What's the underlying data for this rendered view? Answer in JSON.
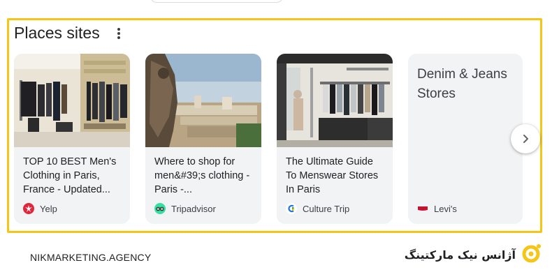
{
  "section": {
    "title": "Places sites",
    "menu_icon": "more-vert-icon"
  },
  "cards": [
    {
      "title": "TOP 10 BEST Men's Clothing in Paris, France - Updated...",
      "source": "Yelp",
      "source_icon": "yelp-logo-icon",
      "accent": "#e0263c"
    },
    {
      "title": "Where to shop for men&#39;s clothing - Paris -...",
      "source": "Tripadvisor",
      "source_icon": "tripadvisor-logo-icon",
      "accent": "#34e0a1"
    },
    {
      "title": "The Ultimate Guide To Menswear Stores In Paris",
      "source": "Culture Trip",
      "source_icon": "culture-trip-logo-icon",
      "accent": "#1a73e8"
    },
    {
      "title": "Denim & Jeans Stores",
      "source": "Levi's",
      "source_icon": "levis-logo-icon",
      "accent": "#c41230"
    }
  ],
  "next_icon": "chevron-right-icon",
  "footer": {
    "left_text": "NIKMARKETING.AGENCY",
    "right_text": "آژانس نیک مارکتینگ",
    "logo_icon": "nik-logo-icon",
    "logo_color": "#f5c518"
  },
  "highlight_color": "#f5c518"
}
